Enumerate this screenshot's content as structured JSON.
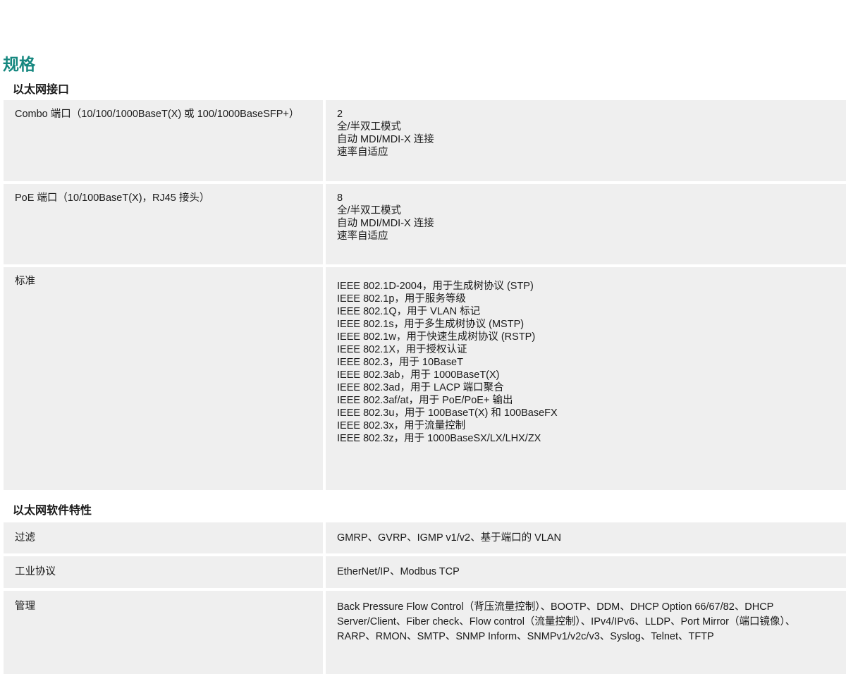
{
  "page": {
    "title": "规格"
  },
  "sections": [
    {
      "title": "以太网接口",
      "rows": [
        {
          "label": "Combo 端口（10/100/1000BaseT(X) 或 100/1000BaseSFP+）",
          "values": [
            "2",
            "全/半双工模式",
            "自动 MDI/MDI-X 连接",
            "速率自适应"
          ]
        },
        {
          "label": "PoE 端口（10/100BaseT(X)，RJ45 接头）",
          "values": [
            "8",
            "全/半双工模式",
            "自动 MDI/MDI-X 连接",
            "速率自适应"
          ]
        },
        {
          "label": "标准",
          "values": [
            "IEEE 802.1D-2004，用于生成树协议 (STP)",
            "IEEE 802.1p，用于服务等级",
            "IEEE 802.1Q，用于 VLAN 标记",
            "IEEE 802.1s，用于多生成树协议 (MSTP)",
            "IEEE 802.1w，用于快速生成树协议 (RSTP)",
            "IEEE 802.1X，用于授权认证",
            "IEEE 802.3，用于 10BaseT",
            "IEEE 802.3ab，用于 1000BaseT(X)",
            "IEEE 802.3ad，用于 LACP 端口聚合",
            "IEEE 802.3af/at，用于 PoE/PoE+ 输出",
            "IEEE 802.3u，用于 100BaseT(X) 和 100BaseFX",
            "IEEE 802.3x，用于流量控制",
            "IEEE 802.3z，用于 1000BaseSX/LX/LHX/ZX"
          ]
        }
      ]
    },
    {
      "title": "以太网软件特性",
      "rows": [
        {
          "label": "过滤",
          "values": [
            "GMRP、GVRP、IGMP v1/v2、基于端口的 VLAN"
          ]
        },
        {
          "label": "工业协议",
          "values": [
            "EtherNet/IP、Modbus TCP"
          ]
        },
        {
          "label": "管理",
          "values": [
            "Back Pressure Flow Control（背压流量控制）、BOOTP、DDM、DHCP Option 66/67/82、DHCP Server/Client、Fiber check、Flow control（流量控制）、IPv4/IPv6、LLDP、Port Mirror（端口镜像）、RARP、RMON、SMTP、SNMP Inform、SNMPv1/v2c/v3、Syslog、Telnet、TFTP"
          ]
        }
      ]
    }
  ]
}
